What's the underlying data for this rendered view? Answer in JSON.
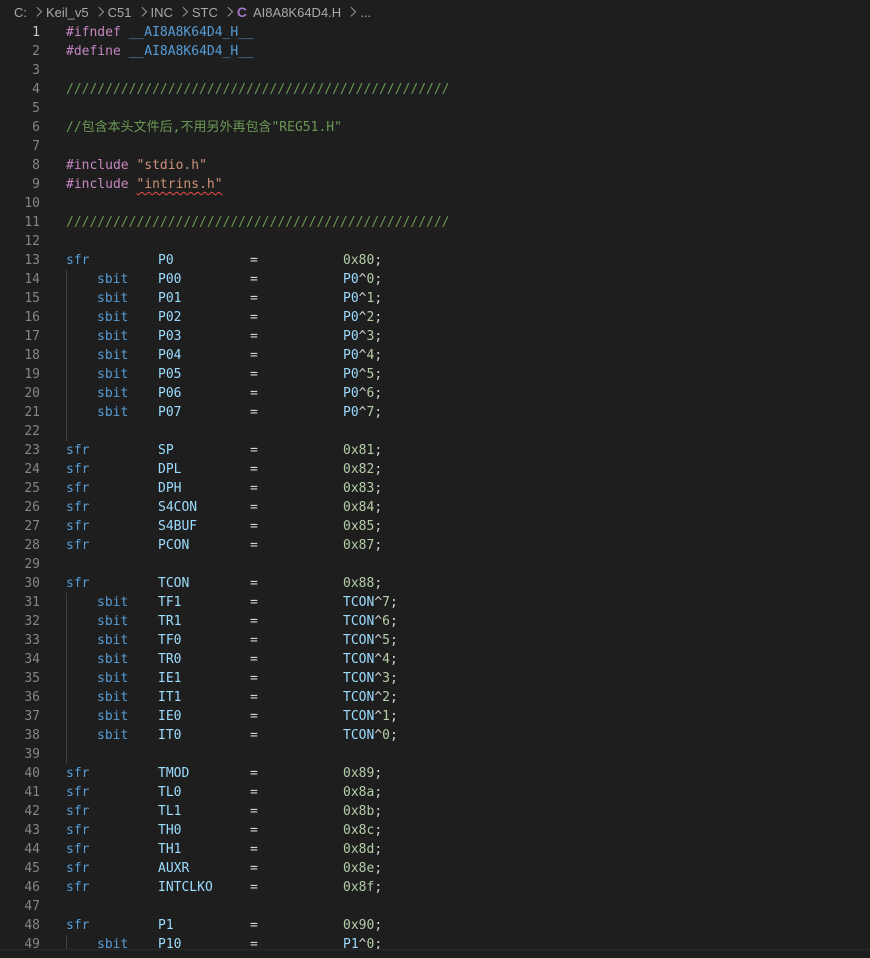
{
  "breadcrumb": {
    "items": [
      "C:",
      "Keil_v5",
      "C51",
      "INC",
      "STC"
    ],
    "file_icon": "C",
    "file": "AI8A8K64D4.H",
    "ellipsis": "..."
  },
  "editor": {
    "active_line": 1,
    "lines": [
      {
        "n": "1",
        "t": "pre",
        "a": "#ifndef",
        "b": "__AI8A8K64D4_H__"
      },
      {
        "n": "2",
        "t": "pre",
        "a": "#define",
        "b": "__AI8A8K64D4_H__"
      },
      {
        "n": "3",
        "t": "blank"
      },
      {
        "n": "4",
        "t": "comment",
        "text": "/////////////////////////////////////////////////"
      },
      {
        "n": "5",
        "t": "blank"
      },
      {
        "n": "6",
        "t": "comment",
        "text": "//包含本头文件后,不用另外再包含\"REG51.H\""
      },
      {
        "n": "7",
        "t": "blank"
      },
      {
        "n": "8",
        "t": "include",
        "a": "#include",
        "b": "\"stdio.h\""
      },
      {
        "n": "9",
        "t": "include",
        "a": "#include",
        "b": "\"intrins.h\"",
        "err": true
      },
      {
        "n": "10",
        "t": "blank"
      },
      {
        "n": "11",
        "t": "comment",
        "text": "/////////////////////////////////////////////////"
      },
      {
        "n": "12",
        "t": "blank"
      },
      {
        "n": "13",
        "t": "sfr",
        "kw": "sfr",
        "name": "P0",
        "op": "=",
        "val": "0x80;"
      },
      {
        "n": "14",
        "t": "sbit",
        "kw": "sbit",
        "name": "P00",
        "op": "=",
        "val": "P0^0;"
      },
      {
        "n": "15",
        "t": "sbit",
        "kw": "sbit",
        "name": "P01",
        "op": "=",
        "val": "P0^1;"
      },
      {
        "n": "16",
        "t": "sbit",
        "kw": "sbit",
        "name": "P02",
        "op": "=",
        "val": "P0^2;"
      },
      {
        "n": "17",
        "t": "sbit",
        "kw": "sbit",
        "name": "P03",
        "op": "=",
        "val": "P0^3;"
      },
      {
        "n": "18",
        "t": "sbit",
        "kw": "sbit",
        "name": "P04",
        "op": "=",
        "val": "P0^4;"
      },
      {
        "n": "19",
        "t": "sbit",
        "kw": "sbit",
        "name": "P05",
        "op": "=",
        "val": "P0^5;"
      },
      {
        "n": "20",
        "t": "sbit",
        "kw": "sbit",
        "name": "P06",
        "op": "=",
        "val": "P0^6;"
      },
      {
        "n": "21",
        "t": "sbit",
        "kw": "sbit",
        "name": "P07",
        "op": "=",
        "val": "P0^7;"
      },
      {
        "n": "22",
        "t": "guide"
      },
      {
        "n": "23",
        "t": "sfr",
        "kw": "sfr",
        "name": "SP",
        "op": "=",
        "val": "0x81;"
      },
      {
        "n": "24",
        "t": "sfr",
        "kw": "sfr",
        "name": "DPL",
        "op": "=",
        "val": "0x82;"
      },
      {
        "n": "25",
        "t": "sfr",
        "kw": "sfr",
        "name": "DPH",
        "op": "=",
        "val": "0x83;"
      },
      {
        "n": "26",
        "t": "sfr",
        "kw": "sfr",
        "name": "S4CON",
        "op": "=",
        "val": "0x84;"
      },
      {
        "n": "27",
        "t": "sfr",
        "kw": "sfr",
        "name": "S4BUF",
        "op": "=",
        "val": "0x85;"
      },
      {
        "n": "28",
        "t": "sfr",
        "kw": "sfr",
        "name": "PCON",
        "op": "=",
        "val": "0x87;"
      },
      {
        "n": "29",
        "t": "blank"
      },
      {
        "n": "30",
        "t": "sfr",
        "kw": "sfr",
        "name": "TCON",
        "op": "=",
        "val": "0x88;"
      },
      {
        "n": "31",
        "t": "sbit",
        "kw": "sbit",
        "name": "TF1",
        "op": "=",
        "val": "TCON^7;"
      },
      {
        "n": "32",
        "t": "sbit",
        "kw": "sbit",
        "name": "TR1",
        "op": "=",
        "val": "TCON^6;"
      },
      {
        "n": "33",
        "t": "sbit",
        "kw": "sbit",
        "name": "TF0",
        "op": "=",
        "val": "TCON^5;"
      },
      {
        "n": "34",
        "t": "sbit",
        "kw": "sbit",
        "name": "TR0",
        "op": "=",
        "val": "TCON^4;"
      },
      {
        "n": "35",
        "t": "sbit",
        "kw": "sbit",
        "name": "IE1",
        "op": "=",
        "val": "TCON^3;"
      },
      {
        "n": "36",
        "t": "sbit",
        "kw": "sbit",
        "name": "IT1",
        "op": "=",
        "val": "TCON^2;"
      },
      {
        "n": "37",
        "t": "sbit",
        "kw": "sbit",
        "name": "IE0",
        "op": "=",
        "val": "TCON^1;"
      },
      {
        "n": "38",
        "t": "sbit",
        "kw": "sbit",
        "name": "IT0",
        "op": "=",
        "val": "TCON^0;"
      },
      {
        "n": "39",
        "t": "guide"
      },
      {
        "n": "40",
        "t": "sfr",
        "kw": "sfr",
        "name": "TMOD",
        "op": "=",
        "val": "0x89;"
      },
      {
        "n": "41",
        "t": "sfr",
        "kw": "sfr",
        "name": "TL0",
        "op": "=",
        "val": "0x8a;"
      },
      {
        "n": "42",
        "t": "sfr",
        "kw": "sfr",
        "name": "TL1",
        "op": "=",
        "val": "0x8b;"
      },
      {
        "n": "43",
        "t": "sfr",
        "kw": "sfr",
        "name": "TH0",
        "op": "=",
        "val": "0x8c;"
      },
      {
        "n": "44",
        "t": "sfr",
        "kw": "sfr",
        "name": "TH1",
        "op": "=",
        "val": "0x8d;"
      },
      {
        "n": "45",
        "t": "sfr",
        "kw": "sfr",
        "name": "AUXR",
        "op": "=",
        "val": "0x8e;"
      },
      {
        "n": "46",
        "t": "sfr",
        "kw": "sfr",
        "name": "INTCLKO",
        "op": "=",
        "val": "0x8f;"
      },
      {
        "n": "47",
        "t": "blank"
      },
      {
        "n": "48",
        "t": "sfr",
        "kw": "sfr",
        "name": "P1",
        "op": "=",
        "val": "0x90;"
      },
      {
        "n": "49",
        "t": "sbit",
        "kw": "sbit",
        "name": "P10",
        "op": "=",
        "val": "P1^0;"
      }
    ]
  }
}
